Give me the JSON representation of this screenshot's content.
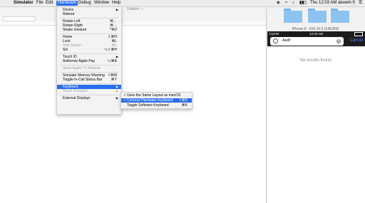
{
  "menubar": {
    "apple": "",
    "app": "Simulator",
    "items": [
      "File",
      "Edit",
      "Hardware",
      "Debug",
      "Window",
      "Help"
    ],
    "active": "Hardware",
    "clock": "Thu 12:03 AM",
    "user": "akwerk"
  },
  "editor": {
    "title": "Untitled —"
  },
  "simulator": {
    "title": "iPhone 6 - iOS 10.3 (14E269)",
    "status": {
      "carrier": "Carrier",
      "time": "12:03 AM"
    },
    "search": {
      "value": "Asdf",
      "cancel": "Cancel"
    },
    "no_results": "No results found."
  },
  "hardware_menu": {
    "device": "Device",
    "reboot": "Reboot",
    "rotate_left": "Rotate Left",
    "rotate_left_key": "⌘←",
    "rotate_right": "Rotate Right",
    "rotate_right_key": "⌘→",
    "shake": "Shake Gesture",
    "shake_key": "^⌘Z",
    "home": "Home",
    "home_key": "⇧⌘H",
    "lock": "Lock",
    "lock_key": "⌘L",
    "side_button": "Side Button",
    "side_button_key": "⌘L",
    "siri": "Siri",
    "siri_key": "⌥⇧⌘H",
    "touch_id": "Touch ID",
    "apple_pay": "Authorize Apple Pay",
    "apple_pay_key": "⌥⌘A",
    "tv_remote": "Show Apple TV Remote",
    "memory_warning": "Simulate Memory Warning",
    "memory_warning_key": "⇧⌘M",
    "call_bar": "Toggle In-Call Status Bar",
    "call_bar_key": "⌘Y",
    "keyboard": "Keyboard",
    "touch_pressure": "Touch Pressure",
    "external_displays": "External Displays"
  },
  "keyboard_submenu": {
    "same_layout": "Uses the Same Layout as macOS",
    "connect_hw": "Connect Hardware Keyboard",
    "connect_hw_key": "⇧⌘K",
    "toggle_sw": "Toggle Software Keyboard",
    "toggle_sw_key": "⌘K"
  }
}
